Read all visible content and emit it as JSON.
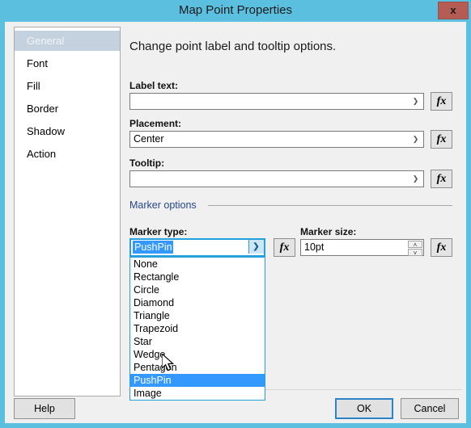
{
  "window": {
    "title": "Map Point Properties",
    "close_label": "x",
    "accent_color": "#5BC0E0",
    "close_color": "#B55C54"
  },
  "sidebar": {
    "items": [
      {
        "label": "General",
        "selected": true
      },
      {
        "label": "Font",
        "selected": false
      },
      {
        "label": "Fill",
        "selected": false
      },
      {
        "label": "Border",
        "selected": false
      },
      {
        "label": "Shadow",
        "selected": false
      },
      {
        "label": "Action",
        "selected": false
      }
    ]
  },
  "main": {
    "heading": "Change point label and tooltip options.",
    "fields": {
      "label_text": {
        "label": "Label text:",
        "value": "",
        "fx": "fx"
      },
      "placement": {
        "label": "Placement:",
        "value": "Center",
        "fx": "fx"
      },
      "tooltip": {
        "label": "Tooltip:",
        "value": "",
        "fx": "fx"
      }
    },
    "marker_options": {
      "group_label": "Marker options",
      "group_label_color": "#26478D",
      "marker_type": {
        "label": "Marker type:",
        "value": "PushPin",
        "fx": "fx",
        "expanded": true,
        "options": [
          "None",
          "Rectangle",
          "Circle",
          "Diamond",
          "Triangle",
          "Trapezoid",
          "Star",
          "Wedge",
          "Pentagon",
          "PushPin",
          "Image"
        ],
        "highlighted_option": "PushPin",
        "highlight_color": "#3399FF"
      },
      "marker_size": {
        "label": "Marker size:",
        "value": "10pt",
        "fx": "fx",
        "spinner_up": "˄",
        "spinner_down": "˅"
      }
    }
  },
  "footer": {
    "help_label": "Help",
    "ok_label": "OK",
    "cancel_label": "Cancel"
  }
}
